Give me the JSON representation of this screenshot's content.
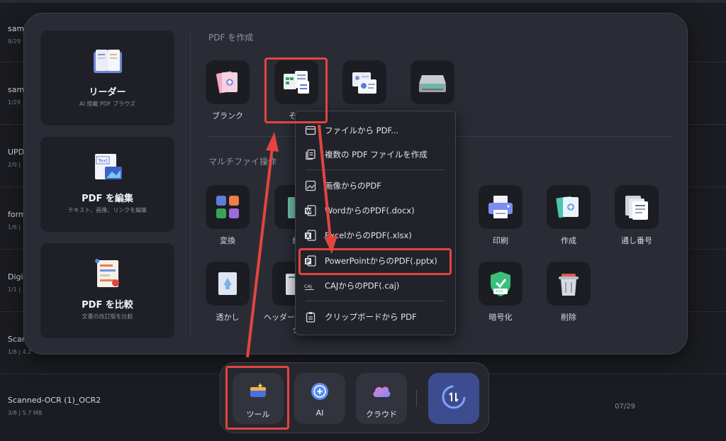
{
  "file_list": {
    "rows": [
      {
        "name": "sam",
        "meta": "9/29"
      },
      {
        "name": "sam",
        "meta": "1/29"
      },
      {
        "name": "UPD",
        "meta": "2/9 |"
      },
      {
        "name": "form",
        "meta": "1/6 |"
      },
      {
        "name": "Digi",
        "meta": "1/1 |"
      },
      {
        "name": "Scan",
        "meta": "1/8 | 4.2"
      },
      {
        "name": "Scanned-OCR (1)_OCR2",
        "meta": "3/8 | 5.7 MB",
        "date": "07/29"
      }
    ]
  },
  "cards": [
    {
      "title": "リーダー",
      "subtitle": "AI 搭載 PDF ブラウズ",
      "icon": "book-icon"
    },
    {
      "title": "PDF を編集",
      "subtitle": "テキスト、画像、リンクを編集",
      "icon": "edit-text-icon"
    },
    {
      "title": "PDF を比較",
      "subtitle": "文書の改訂版を比較",
      "icon": "compare-icon"
    }
  ],
  "create_section": {
    "title": "PDF を作成",
    "tools": [
      {
        "label": "ブランク",
        "icon": "blank-page-icon"
      },
      {
        "label": "その",
        "icon": "other-files-icon"
      },
      {
        "label": "",
        "icon": "id-card-icon"
      },
      {
        "label": "",
        "icon": "scanner-icon"
      }
    ]
  },
  "multi_section": {
    "title": "マルチファイ",
    "title_tail": "操作",
    "tools": [
      {
        "label": "変換",
        "icon": "convert-icon"
      },
      {
        "label": "結",
        "icon": "combine-icon"
      },
      {
        "label": "ズ",
        "icon": "hidden-icon"
      },
      {
        "label": "印刷",
        "icon": "printer-icon"
      },
      {
        "label": "作成",
        "icon": "create-icon"
      },
      {
        "label": "通し番号",
        "icon": "bates-number-icon"
      },
      {
        "label": "透かし",
        "icon": "watermark-icon"
      },
      {
        "label": "ヘッダー",
        "label2": "タ",
        "icon": "header-footer-icon"
      },
      {
        "label": "暗号化",
        "icon": "encrypt-shield-icon"
      },
      {
        "label": "削除",
        "icon": "trash-icon"
      }
    ]
  },
  "dropdown": {
    "items": [
      {
        "label": "ファイルから PDF...",
        "icon": "file-icon"
      },
      {
        "label": "複数の PDF ファイルを作成",
        "icon": "multi-file-icon"
      },
      {
        "label": "画像からのPDF",
        "icon": "image-icon"
      },
      {
        "label": "WordからのPDF(.docx)",
        "icon": "word-icon"
      },
      {
        "label": "ExcelからのPDF(.xlsx)",
        "icon": "excel-icon"
      },
      {
        "label": "PowerPointからのPDF(.pptx)",
        "icon": "powerpoint-icon"
      },
      {
        "label": "CAJからのPDF(.caj)",
        "icon": "caj-icon"
      },
      {
        "label": "クリップボードから PDF",
        "icon": "clipboard-icon"
      }
    ]
  },
  "dock": {
    "tools_label": "ツール",
    "ai_label": "AI",
    "cloud_label": "クラウド"
  },
  "colors": {
    "accent_red": "#e2453f",
    "panel_bg": "#2a2c35",
    "sync_blue": "#3d4c8e"
  }
}
